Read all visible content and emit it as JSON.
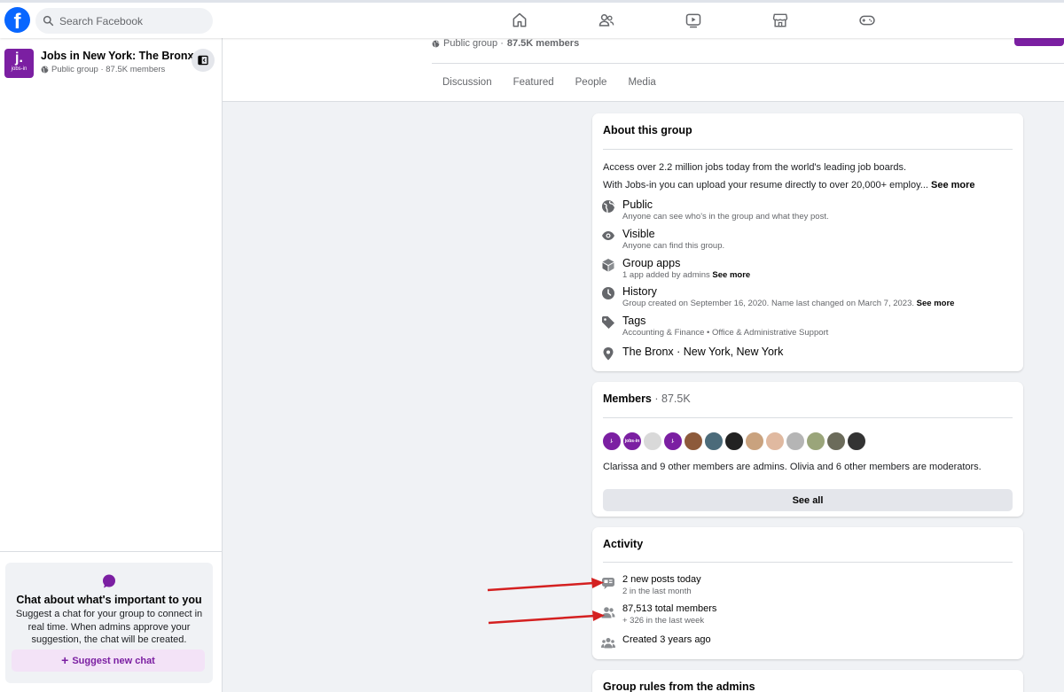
{
  "topbar": {
    "logo_letter": "f",
    "search_placeholder": "Search Facebook",
    "nav": [
      "home-icon",
      "friends-icon",
      "video-icon",
      "marketplace-icon",
      "gaming-icon"
    ]
  },
  "sidebar": {
    "group_avatar_letter": "j.",
    "group_avatar_text": "jobs-in",
    "group_name": "Jobs in New York: The Bronx",
    "group_meta": "Public group · 87.5K members",
    "chat_title": "Chat about what's important to you",
    "chat_desc": "Suggest a chat for your group to connect in real time. When admins approve your suggestion, the chat will be created.",
    "suggest_label": "Suggest new chat"
  },
  "header": {
    "meta_prefix": "Public group · ",
    "meta_members": "87.5K members",
    "tabs": [
      "Discussion",
      "Featured",
      "People",
      "Media"
    ]
  },
  "about": {
    "title": "About this group",
    "line1": "Access over 2.2 million jobs today from the world's leading job boards.",
    "line2": "With Jobs-in you can upload your resume directly to over 20,000+ employ...",
    "see_more": "See more",
    "public_title": "Public",
    "public_sub": "Anyone can see who's in the group and what they post.",
    "visible_title": "Visible",
    "visible_sub": "Anyone can find this group.",
    "apps_title": "Group apps",
    "apps_sub": "1 app added by admins",
    "history_title": "History",
    "history_sub": "Group created on September 16, 2020. Name last changed on March 7, 2023.",
    "tags_title": "Tags",
    "tags_sub": "Accounting & Finance • Office & Administrative Support",
    "location": "The Bronx · New York, New York"
  },
  "members": {
    "title": "Members",
    "count": " · 87.5K",
    "avatar_colors": [
      "#7b1fa2",
      "#7b1fa2",
      "#d9d9d9",
      "#7b1fa2",
      "#8d5a3b",
      "#4b6b7a",
      "#222222",
      "#c9a27e",
      "#e0b9a0",
      "#b5b5b5",
      "#9aa57a",
      "#6b6b5a",
      "#333333"
    ],
    "avatar_labels": [
      "j.",
      "jobs-in",
      "",
      "j.",
      "",
      "",
      "",
      "",
      "",
      "",
      "",
      "",
      ""
    ],
    "admins_text": "Clarissa and 9 other members are admins. Olivia and 6 other members are moderators.",
    "see_all": "See all"
  },
  "activity": {
    "title": "Activity",
    "posts_title": "2 new posts today",
    "posts_sub": "2 in the last month",
    "members_title": "87,513 total members",
    "members_sub": "+ 326 in the last week",
    "created": "Created 3 years ago"
  },
  "rules": {
    "title": "Group rules from the admins"
  },
  "colors": {
    "brand_purple": "#7b1fa2",
    "facebook_blue": "#0866ff",
    "annotation_red": "#d42020"
  }
}
